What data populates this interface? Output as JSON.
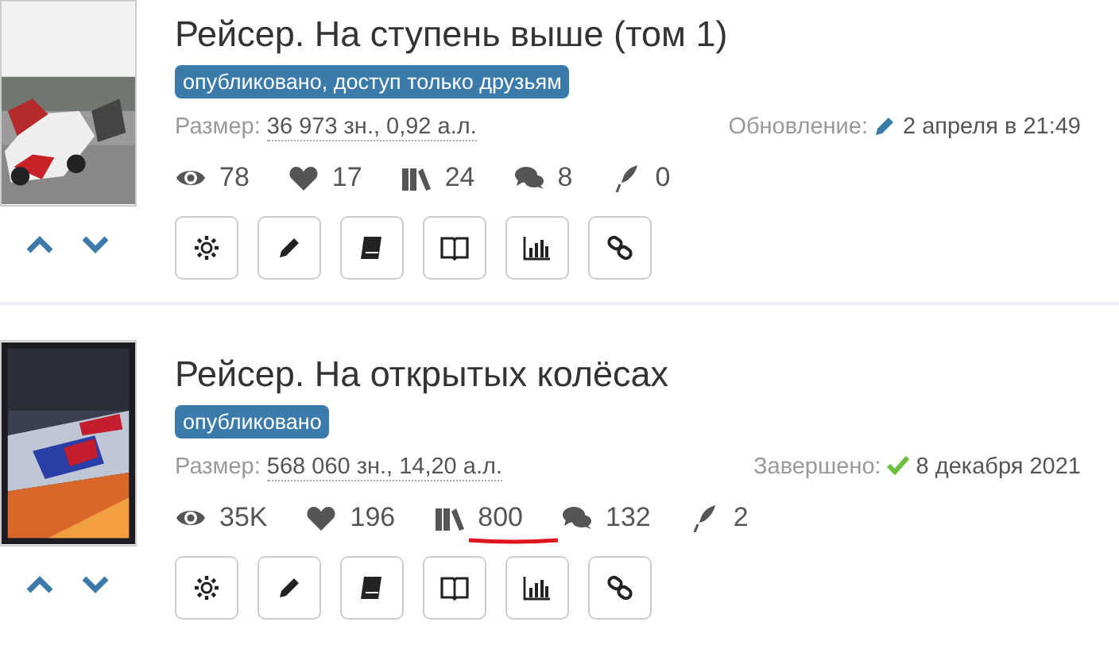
{
  "works": [
    {
      "title": "Рейсер. На ступень выше (том 1)",
      "badge": "опубликовано, доступ только друзьям",
      "size_label": "Размер:",
      "size_value": "36 973 зн., 0,92 а.л.",
      "status_label": "Обновление:",
      "kind": "updated",
      "status_value": "2 апреля в 21:49",
      "stats": [
        {
          "kind": "views",
          "value": "78",
          "underlined": false
        },
        {
          "kind": "likes",
          "value": "17",
          "underlined": false
        },
        {
          "kind": "library",
          "value": "24",
          "underlined": false
        },
        {
          "kind": "comments",
          "value": "8",
          "underlined": false
        },
        {
          "kind": "reviews",
          "value": "0",
          "underlined": false
        }
      ]
    },
    {
      "title": "Рейсер. На открытых колёсах",
      "badge": "опубликовано",
      "size_label": "Размер:",
      "size_value": "568 060 зн., 14,20 а.л.",
      "status_label": "Завершено:",
      "kind": "finished",
      "status_value": "8 декабря 2021",
      "stats": [
        {
          "kind": "views",
          "value": "35K",
          "underlined": false
        },
        {
          "kind": "likes",
          "value": "196",
          "underlined": false
        },
        {
          "kind": "library",
          "value": "800",
          "underlined": true
        },
        {
          "kind": "comments",
          "value": "132",
          "underlined": false
        },
        {
          "kind": "reviews",
          "value": "2",
          "underlined": false
        }
      ]
    }
  ]
}
